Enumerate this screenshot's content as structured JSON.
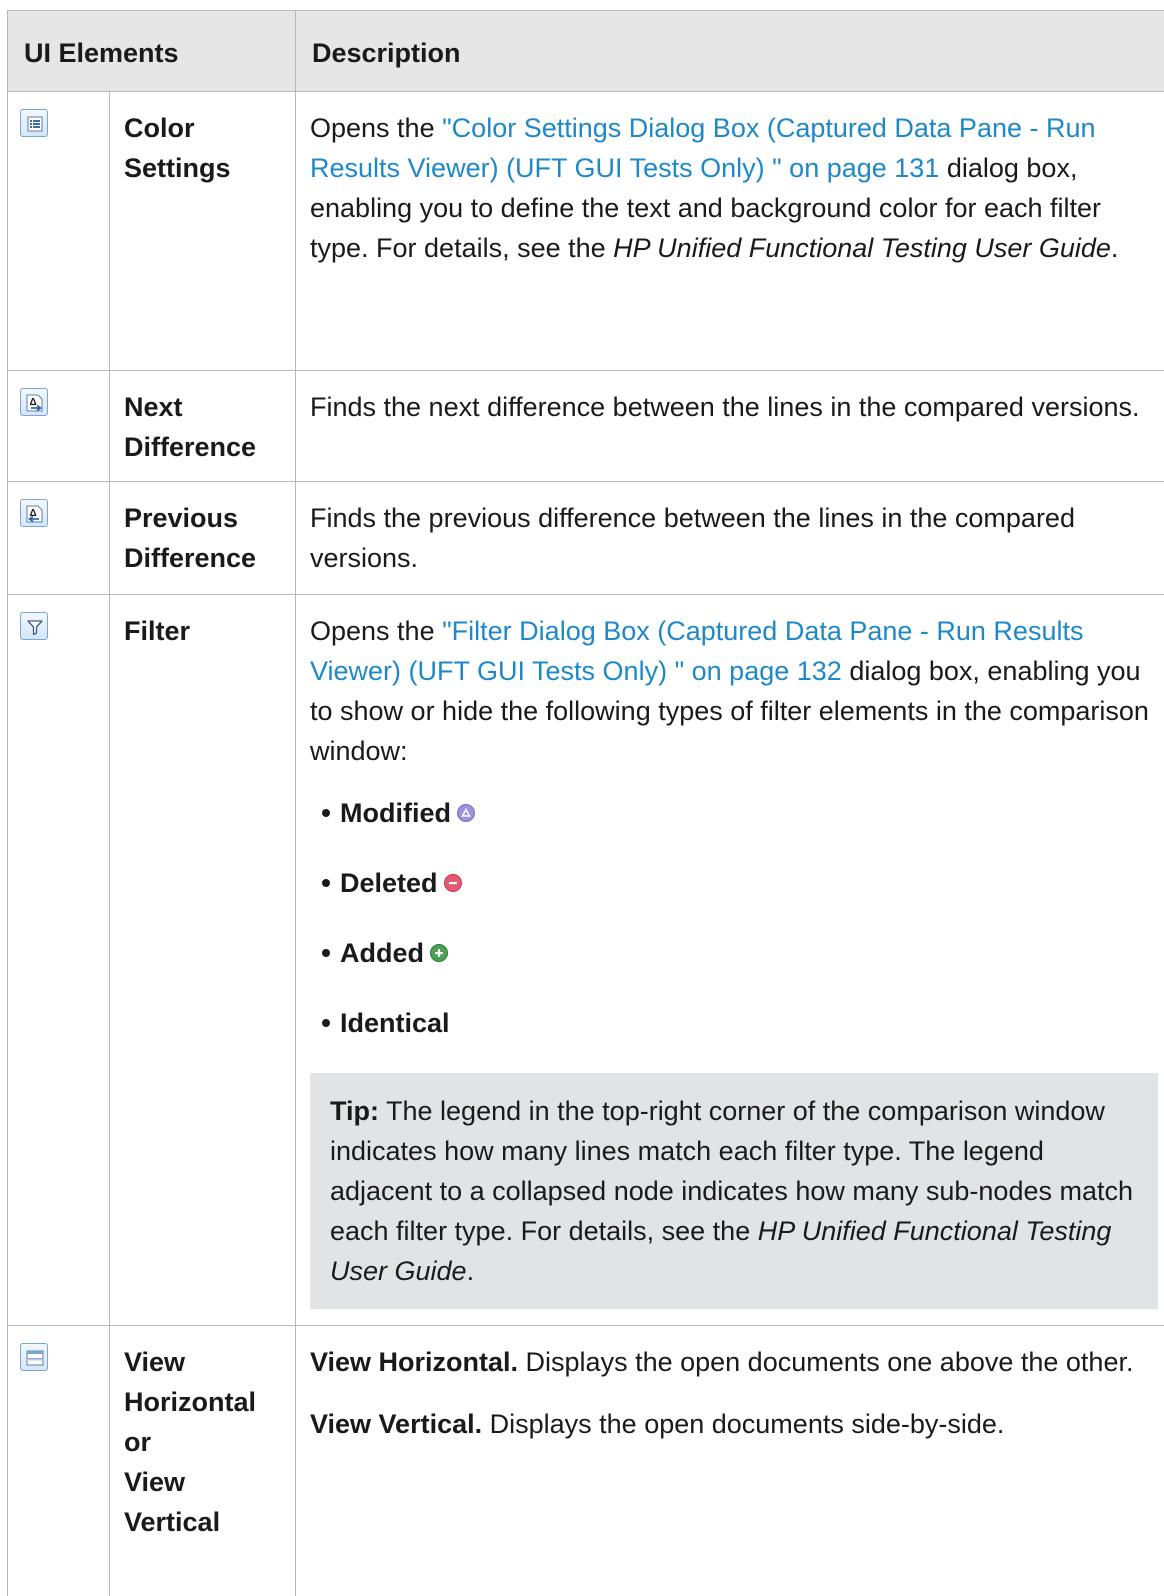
{
  "headers": {
    "ui_elements": "UI Elements",
    "description": "Description"
  },
  "rows": {
    "color_settings": {
      "icon": "color-settings-icon",
      "name": "Color Settings",
      "desc_pre": "Opens the ",
      "link": "\"Color Settings Dialog Box (Captured Data Pane - Run Results Viewer) (UFT GUI Tests Only) \" on page 131",
      "desc_mid": " dialog box, enabling you to define the text and background color for each filter type. For details, see the ",
      "guide": "HP Unified Functional Testing User Guide",
      "desc_end": "."
    },
    "next_difference": {
      "icon": "next-difference-icon",
      "name": "Next Difference",
      "desc": "Finds the next difference between the lines in the compared versions."
    },
    "previous_difference": {
      "icon": "previous-difference-icon",
      "name": "Previous Difference",
      "desc": "Finds the previous difference between the lines in the compared versions."
    },
    "filter": {
      "icon": "filter-icon",
      "name": "Filter",
      "desc_pre": "Opens the ",
      "link": "\"Filter Dialog Box (Captured Data Pane - Run Results Viewer) (UFT GUI Tests Only) \" on page 132",
      "desc_end": " dialog box, enabling you to show or hide the following types of filter elements in the comparison window:",
      "items": [
        {
          "label": "Modified",
          "icon": "modified-icon",
          "color": "#8f86d6"
        },
        {
          "label": "Deleted",
          "icon": "deleted-icon",
          "color": "#e0506a"
        },
        {
          "label": "Added",
          "icon": "added-icon",
          "color": "#3f9a46"
        },
        {
          "label": "Identical"
        }
      ],
      "tip_label": "Tip:",
      "tip_text": " The legend in the top-right corner of the comparison window indicates how many lines match each filter type. The legend adjacent to a collapsed node indicates how many sub-nodes match each filter type. For details, see the ",
      "tip_guide": "HP Unified Functional Testing User Guide",
      "tip_end": "."
    },
    "view": {
      "icon": "view-horizontal-icon",
      "name_lines": [
        "View",
        "Horizontal",
        "or",
        "View",
        "Vertical"
      ],
      "horizontal_label": "View Horizontal.",
      "horizontal_text": " Displays the open documents one above the other.",
      "vertical_label": "View Vertical.",
      "vertical_text": " Displays the open documents side-by-side."
    }
  },
  "colors": {
    "link": "#1e88c8",
    "header_bg": "#e6e6e6",
    "tip_bg": "#e1e4e6",
    "border": "#b8b8b8"
  }
}
